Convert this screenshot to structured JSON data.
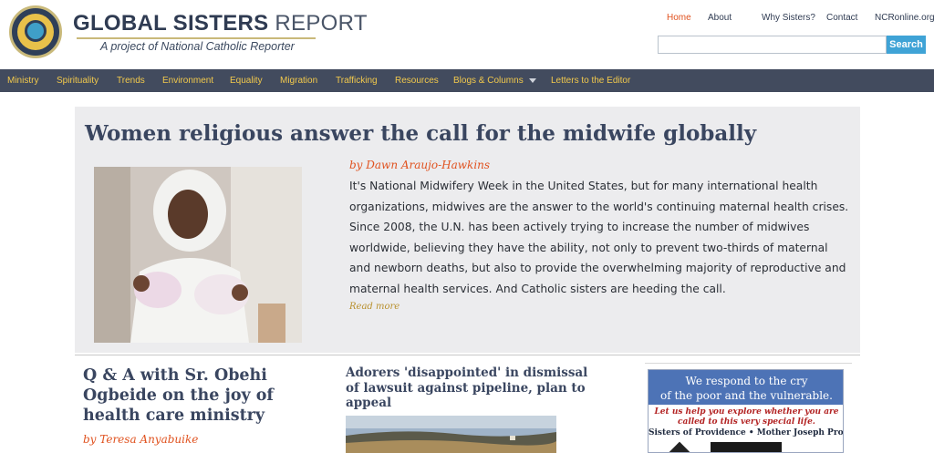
{
  "brand": {
    "title_bold": "GLOBAL SISTERS",
    "title_light": "REPORT",
    "tagline": "A project of National Catholic Reporter"
  },
  "top_nav": [
    {
      "label": "Home",
      "active": true
    },
    {
      "label": "About"
    },
    {
      "label": "Why Sisters?"
    },
    {
      "label": "Contact"
    },
    {
      "label": "NCRonline.org"
    }
  ],
  "search": {
    "value": "",
    "button_label": "Search"
  },
  "main_nav": [
    "Ministry",
    "Spirituality",
    "Trends",
    "Environment",
    "Equality",
    "Migration",
    "Trafficking",
    "Resources",
    "Blogs & Columns",
    "Letters to the Editor"
  ],
  "featured": {
    "title": "Women religious answer the call for the midwife globally",
    "byline": "by Dawn Araujo-Hawkins",
    "body": "It's National Midwifery Week in the United States, but for many international health organizations, midwives are the answer to the world's continuing maternal health crises. Since 2008, the U.N. has been actively trying to increase the number of midwives worldwide, believing they have the ability, not only to prevent two-thirds of maternal and newborn deaths, but also to provide the overwhelming majority of reproductive and maternal health services. And Catholic sisters are heeding the call.",
    "read_more": "Read more"
  },
  "stories": [
    {
      "title": "Q & A with Sr. Obehi Ogbeide on the joy of health care ministry",
      "byline": "by Teresa Anyabuike"
    },
    {
      "title": "Adorers 'disappointed' in dismissal of lawsuit against pipeline, plan to appeal"
    }
  ],
  "ad": {
    "line1": "We respond to the cry",
    "line2": "of the poor and the vulnerable.",
    "sub1": "Let us help you explore whether you are",
    "sub2": "called to this very special life.",
    "org": "Sisters of Providence • Mother Joseph Province"
  },
  "colors": {
    "accent": "#e0521f",
    "navbar": "#424b5e",
    "nav_text": "#f2c94c",
    "search_button": "#3fa3d6"
  }
}
